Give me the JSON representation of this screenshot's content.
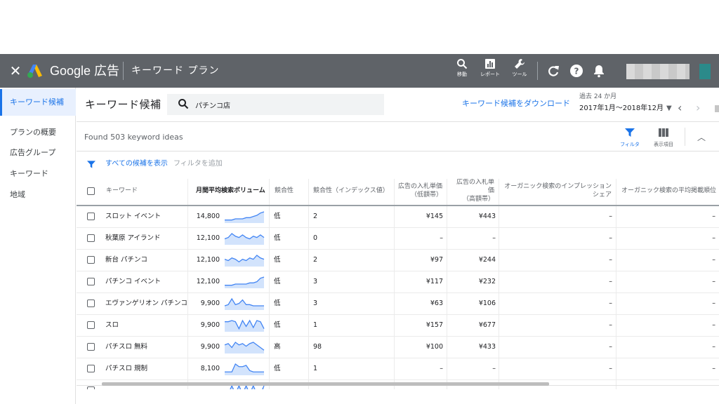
{
  "topbar": {
    "brand": "Google 広告",
    "section": "キーワード プラン",
    "tools": [
      {
        "label": "移動",
        "icon": "search-icon"
      },
      {
        "label": "レポート",
        "icon": "report-icon"
      },
      {
        "label": "ツール",
        "icon": "wrench-icon"
      }
    ]
  },
  "sidebar": {
    "items": [
      {
        "label": "キーワード候補",
        "active": true
      },
      {
        "label": "プランの概要",
        "active": false
      },
      {
        "label": "広告グループ",
        "active": false
      },
      {
        "label": "キーワード",
        "active": false
      },
      {
        "label": "地域",
        "active": false
      }
    ]
  },
  "header": {
    "title": "キーワード候補",
    "search_value": "パチンコ店",
    "download_link": "キーワード候補をダウンロード",
    "period_label": "過去 24 か月",
    "period_value": "2017年1月～2018年12月"
  },
  "toolbar": {
    "found_text": "Found 503 keyword ideas",
    "filter_label": "フィルタ",
    "columns_label": "表示項目"
  },
  "filterbar": {
    "show_all": "すべての候補を表示",
    "add_filter": "フィルタを追加"
  },
  "table": {
    "headers": {
      "keyword": "キーワード",
      "volume": "月間平均検索ボリューム",
      "competition": "競合性",
      "competition_index": "競合性（インデックス値）",
      "bid_low_1": "広告の入札単価",
      "bid_low_2": "（低額帯）",
      "bid_high_1": "広告の入札単価",
      "bid_high_2": "（高額帯）",
      "organic_impr_1": "オーガニック検索のインプレッション",
      "organic_impr_2": "シェア",
      "organic_pos": "オーガニック検索の平均掲載順位"
    },
    "rows": [
      {
        "keyword": "スロット イベント",
        "volume": "14,800",
        "competition": "低",
        "index": "2",
        "bid_low": "¥145",
        "bid_high": "¥443",
        "organic_impr": "–",
        "organic_pos": "–",
        "trend": [
          2,
          2,
          2,
          3,
          3,
          3,
          4,
          4,
          5,
          6,
          8,
          9
        ]
      },
      {
        "keyword": "秋葉原 アイランド",
        "volume": "12,100",
        "competition": "低",
        "index": "0",
        "bid_low": "–",
        "bid_high": "–",
        "organic_impr": "–",
        "organic_pos": "–",
        "trend": [
          4,
          5,
          8,
          6,
          5,
          7,
          5,
          4,
          6,
          5,
          7,
          5
        ]
      },
      {
        "keyword": "新台 パチンコ",
        "volume": "12,100",
        "competition": "低",
        "index": "2",
        "bid_low": "¥97",
        "bid_high": "¥244",
        "organic_impr": "–",
        "organic_pos": "–",
        "trend": [
          5,
          4,
          6,
          5,
          3,
          5,
          4,
          6,
          5,
          8,
          6,
          5
        ]
      },
      {
        "keyword": "パチンコ イベント",
        "volume": "12,100",
        "competition": "低",
        "index": "3",
        "bid_low": "¥117",
        "bid_high": "¥232",
        "organic_impr": "–",
        "organic_pos": "–",
        "trend": [
          2,
          2,
          2,
          3,
          3,
          3,
          3,
          4,
          4,
          5,
          8,
          9
        ]
      },
      {
        "keyword": "エヴァンゲリオン パチンコ",
        "volume": "9,900",
        "competition": "低",
        "index": "3",
        "bid_low": "¥63",
        "bid_high": "¥106",
        "organic_impr": "–",
        "organic_pos": "–",
        "trend": [
          3,
          4,
          9,
          4,
          5,
          8,
          4,
          4,
          3,
          3,
          3,
          3
        ]
      },
      {
        "keyword": "スロ",
        "volume": "9,900",
        "competition": "低",
        "index": "1",
        "bid_low": "¥157",
        "bid_high": "¥677",
        "organic_impr": "–",
        "organic_pos": "–",
        "trend": [
          8,
          8,
          9,
          8,
          2,
          9,
          4,
          9,
          3,
          9,
          8,
          2
        ]
      },
      {
        "keyword": "パチスロ 無料",
        "volume": "9,900",
        "competition": "高",
        "index": "98",
        "bid_low": "¥100",
        "bid_high": "¥433",
        "organic_impr": "–",
        "organic_pos": "–",
        "trend": [
          6,
          7,
          4,
          8,
          6,
          7,
          5,
          7,
          8,
          6,
          4,
          2
        ]
      },
      {
        "keyword": "パチスロ 規制",
        "volume": "8,100",
        "competition": "低",
        "index": "1",
        "bid_low": "–",
        "bid_high": "–",
        "organic_impr": "–",
        "organic_pos": "–",
        "trend": [
          2,
          2,
          2,
          8,
          6,
          6,
          7,
          3,
          2,
          2,
          2,
          2
        ]
      },
      {
        "keyword": "",
        "volume": "",
        "competition": "",
        "index": "",
        "bid_low": "",
        "bid_high": "",
        "organic_impr": "",
        "organic_pos": "",
        "trend": [
          2,
          2,
          9,
          2,
          9,
          2,
          9,
          2,
          9,
          2,
          2,
          9
        ]
      }
    ]
  },
  "colors": {
    "topbar": "#5f6368",
    "accent": "#1a73e8",
    "spark_line": "#4285f4",
    "spark_fill": "#d2e3fc"
  }
}
